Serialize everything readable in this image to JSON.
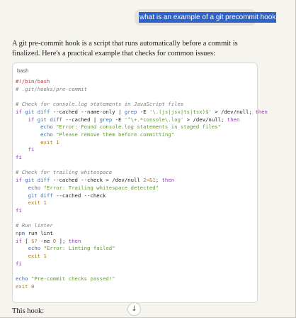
{
  "chat": {
    "user_message": "what is an example of a git precommit hook",
    "intro": "A git pre-commit hook is a script that runs automatically before a commit is finalized. Here's a practical example that checks for common issues:",
    "code_lang": "bash",
    "footer_text": "This hook:",
    "scroll_icon": "↓"
  },
  "code_lines": [
    [
      [
        "sh",
        "#!/bin/bash"
      ]
    ],
    [
      [
        "c",
        "# .git/hooks/pre-commit"
      ]
    ],
    [
      [
        "",
        ""
      ]
    ],
    [
      [
        "c",
        "# Check for console.log statements in JavaScript files"
      ]
    ],
    [
      [
        "k",
        "if "
      ],
      [
        "b",
        "git diff"
      ],
      [
        "",
        " --cached --name-only | "
      ],
      [
        "b",
        "grep"
      ],
      [
        "",
        " -E "
      ],
      [
        "s",
        "'\\.(js|jsx|ts|tsx)$'"
      ],
      [
        "",
        " > /dev/null; "
      ],
      [
        "k",
        "then"
      ]
    ],
    [
      [
        "",
        "    "
      ],
      [
        "k",
        "if "
      ],
      [
        "b",
        "git diff"
      ],
      [
        "",
        " --cached | "
      ],
      [
        "b",
        "grep"
      ],
      [
        "",
        " -E "
      ],
      [
        "s",
        "'^\\+.*console\\.log'"
      ],
      [
        "",
        " > /dev/null; "
      ],
      [
        "k",
        "then"
      ]
    ],
    [
      [
        "",
        "        "
      ],
      [
        "b",
        "echo"
      ],
      [
        "s",
        " \"Error: Found console.log statements in staged files\""
      ]
    ],
    [
      [
        "",
        "        "
      ],
      [
        "b",
        "echo"
      ],
      [
        "s",
        " \"Please remove them before committing\""
      ]
    ],
    [
      [
        "",
        "        "
      ],
      [
        "n",
        "exit 1"
      ]
    ],
    [
      [
        "",
        "    "
      ],
      [
        "k",
        "fi"
      ]
    ],
    [
      [
        "k",
        "fi"
      ]
    ],
    [
      [
        "",
        ""
      ]
    ],
    [
      [
        "c",
        "# Check for trailing whitespace"
      ]
    ],
    [
      [
        "k",
        "if "
      ],
      [
        "b",
        "git diff"
      ],
      [
        "",
        " --cached --check > /dev/null "
      ],
      [
        "n",
        "2>&1"
      ],
      [
        "",
        "; "
      ],
      [
        "k",
        "then"
      ]
    ],
    [
      [
        "",
        "    "
      ],
      [
        "b",
        "echo"
      ],
      [
        "s",
        " \"Error: Trailing whitespace detected\""
      ]
    ],
    [
      [
        "",
        "    "
      ],
      [
        "b",
        "git diff"
      ],
      [
        "",
        " --cached --check"
      ]
    ],
    [
      [
        "",
        "    "
      ],
      [
        "n",
        "exit 1"
      ]
    ],
    [
      [
        "k",
        "fi"
      ]
    ],
    [
      [
        "",
        ""
      ]
    ],
    [
      [
        "c",
        "# Run linter"
      ]
    ],
    [
      [
        "b",
        "npm"
      ],
      [
        "",
        " run lint"
      ]
    ],
    [
      [
        "k",
        "if "
      ],
      [
        "",
        "[ "
      ],
      [
        "n",
        "$?"
      ],
      [
        "",
        " -ne "
      ],
      [
        "n",
        "0"
      ],
      [
        "",
        " ]; "
      ],
      [
        "k",
        "then"
      ]
    ],
    [
      [
        "",
        "    "
      ],
      [
        "b",
        "echo"
      ],
      [
        "s",
        " \"Error: Linting failed\""
      ]
    ],
    [
      [
        "",
        "    "
      ],
      [
        "n",
        "exit 1"
      ]
    ],
    [
      [
        "k",
        "fi"
      ]
    ],
    [
      [
        "",
        ""
      ]
    ],
    [
      [
        "b",
        "echo"
      ],
      [
        "s",
        " \"Pre-commit checks passed!\""
      ]
    ],
    [
      [
        "n",
        "exit 0"
      ]
    ]
  ]
}
